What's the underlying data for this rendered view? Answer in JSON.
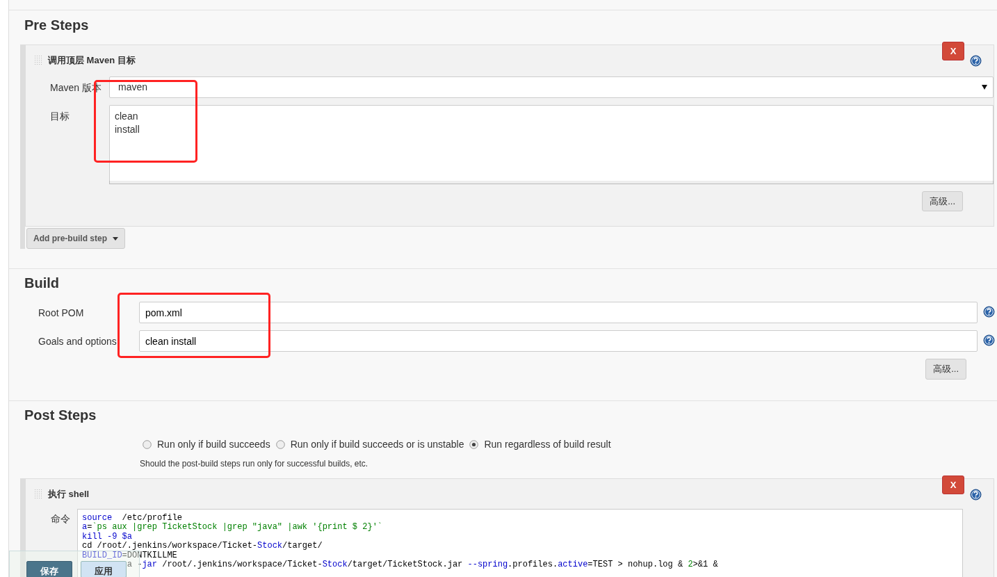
{
  "pre_steps": {
    "title": "Pre Steps",
    "step": {
      "title": "调用顶层 Maven 目标",
      "delete": "X",
      "highlighted": true,
      "advanced": "高级...",
      "fields": [
        {
          "kind": "select",
          "label": "Maven 版本",
          "value": "maven"
        },
        {
          "kind": "textarea",
          "label": "目标",
          "value": "clean\ninstall"
        }
      ]
    },
    "add_button": "Add pre-build step"
  },
  "build": {
    "title": "Build",
    "highlighted": true,
    "advanced": "高级...",
    "fields": [
      {
        "kind": "text",
        "label": "Root POM",
        "value": "pom.xml"
      },
      {
        "kind": "text",
        "label": "Goals and options",
        "value": "clean install"
      }
    ]
  },
  "post_steps": {
    "title": "Post Steps",
    "options": [
      {
        "label": "Run only if build succeeds",
        "selected": false
      },
      {
        "label": "Run only if build succeeds or is unstable",
        "selected": false
      },
      {
        "label": "Run regardless of build result",
        "selected": true
      }
    ],
    "hint": "Should the post-build steps run only for successful builds, etc.",
    "step": {
      "title": "执行 shell",
      "delete": "X",
      "label": "命令",
      "code": [
        [
          {
            "kind": "keyword",
            "text": "source"
          },
          {
            "kind": "plain",
            "text": "  /etc/profile"
          }
        ],
        [
          {
            "kind": "keyword",
            "text": "a"
          },
          {
            "kind": "plain",
            "text": "="
          },
          {
            "kind": "string",
            "text": "`ps aux |grep TicketStock |grep ″java″ |awk '{print $ 2}'`"
          }
        ],
        [
          {
            "kind": "keyword",
            "text": "kill -9 $a"
          }
        ],
        [
          {
            "kind": "plain",
            "text": "cd /root/.jenkins/workspace/Ticket-"
          },
          {
            "kind": "keyword",
            "text": "Stock"
          },
          {
            "kind": "plain",
            "text": "/target/"
          }
        ],
        [
          {
            "kind": "keyword",
            "text": "BUILD_ID"
          },
          {
            "kind": "plain",
            "text": "=DONTKILLME"
          }
        ],
        [
          {
            "kind": "plain",
            "text": "a -"
          },
          {
            "kind": "keyword",
            "text": "jar"
          },
          {
            "kind": "plain",
            "text": " /root/.jenkins/workspace/Ticket-"
          },
          {
            "kind": "keyword",
            "text": "Stock"
          },
          {
            "kind": "plain",
            "text": "/target/TicketStock.jar "
          },
          {
            "kind": "keyword",
            "text": "--spring"
          },
          {
            "kind": "plain",
            "text": ".profiles."
          },
          {
            "kind": "keyword",
            "text": "active"
          },
          {
            "kind": "plain",
            "text": "=TEST > nohup.log & "
          },
          {
            "kind": "string",
            "text": "2"
          },
          {
            "kind": "plain",
            "text": ">&1 &"
          }
        ]
      ]
    }
  },
  "footer": {
    "buttons": [
      {
        "kind": "primary",
        "label": "保存"
      },
      {
        "kind": "secondary",
        "label": "应用"
      }
    ]
  }
}
